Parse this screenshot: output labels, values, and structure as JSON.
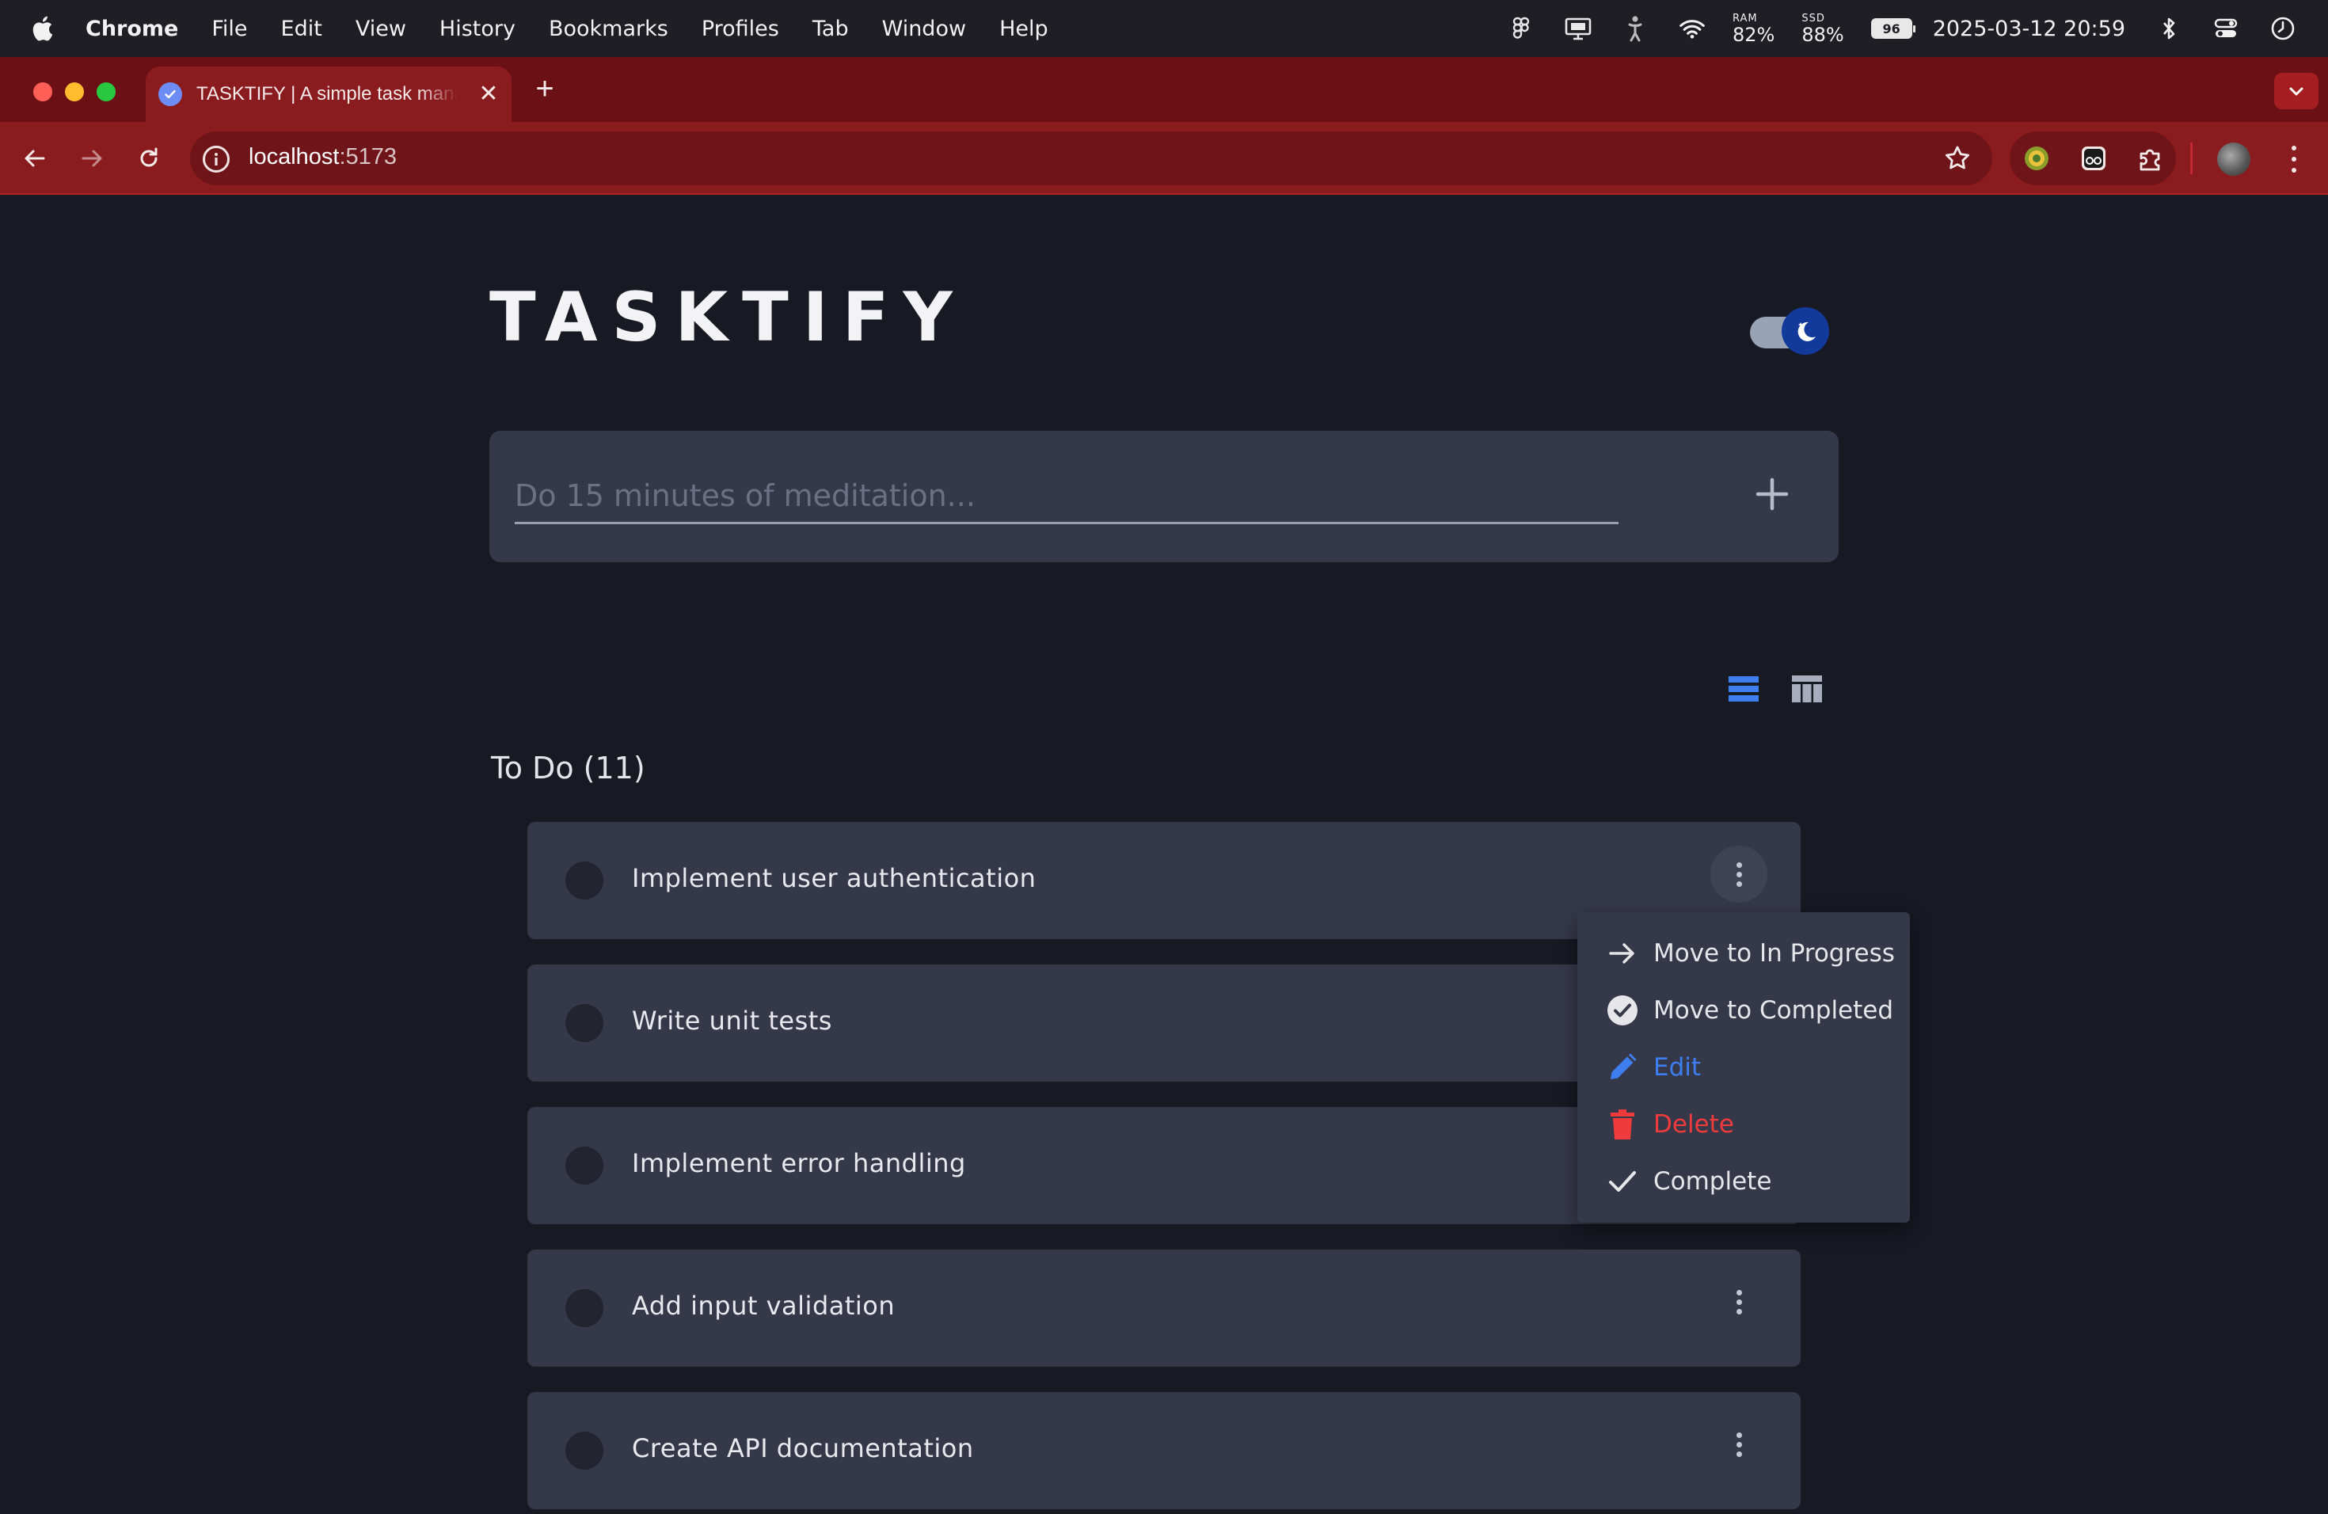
{
  "menubar": {
    "app_name": "Chrome",
    "items": [
      "File",
      "Edit",
      "View",
      "History",
      "Bookmarks",
      "Profiles",
      "Tab",
      "Window",
      "Help"
    ],
    "ram_label": "RAM",
    "ram_value": "82%",
    "ssd_label": "SSD",
    "ssd_value": "88%",
    "battery": "96",
    "datetime": "2025-03-12 20:59"
  },
  "browser": {
    "tab_title": "TASKTIFY | A simple task manager",
    "tab_close": "✕",
    "new_tab": "+",
    "url_host": "localhost",
    "url_port": ":5173"
  },
  "app": {
    "title": "TASKTIFY",
    "theme": "dark",
    "new_task": {
      "placeholder": "Do 15 minutes of meditation...",
      "value": ""
    },
    "active_view": "list",
    "section": {
      "title": "To Do (11)",
      "tasks": [
        {
          "title": "Implement user authentication",
          "menu_open": true
        },
        {
          "title": "Write unit tests",
          "menu_open": false
        },
        {
          "title": "Implement error handling",
          "menu_open": false
        },
        {
          "title": "Add input validation",
          "menu_open": false
        },
        {
          "title": "Create API documentation",
          "menu_open": false
        }
      ]
    },
    "context_menu": {
      "items": [
        {
          "label": "Move to In Progress",
          "icon": "arrow-right-icon",
          "color": "#e6e6ea"
        },
        {
          "label": "Move to Completed",
          "icon": "check-circle-icon",
          "color": "#e6e6ea"
        },
        {
          "label": "Edit",
          "icon": "pencil-icon",
          "color": "#3d7ff0"
        },
        {
          "label": "Delete",
          "icon": "trash-icon",
          "color": "#ef3b3b"
        },
        {
          "label": "Complete",
          "icon": "check-icon",
          "color": "#e6e6ea"
        }
      ]
    }
  },
  "colors": {
    "background": "#171923",
    "card": "#353849",
    "accent_blue": "#3d7ff0",
    "danger_red": "#ef3b3b",
    "browser_red": "#8a1c20"
  }
}
